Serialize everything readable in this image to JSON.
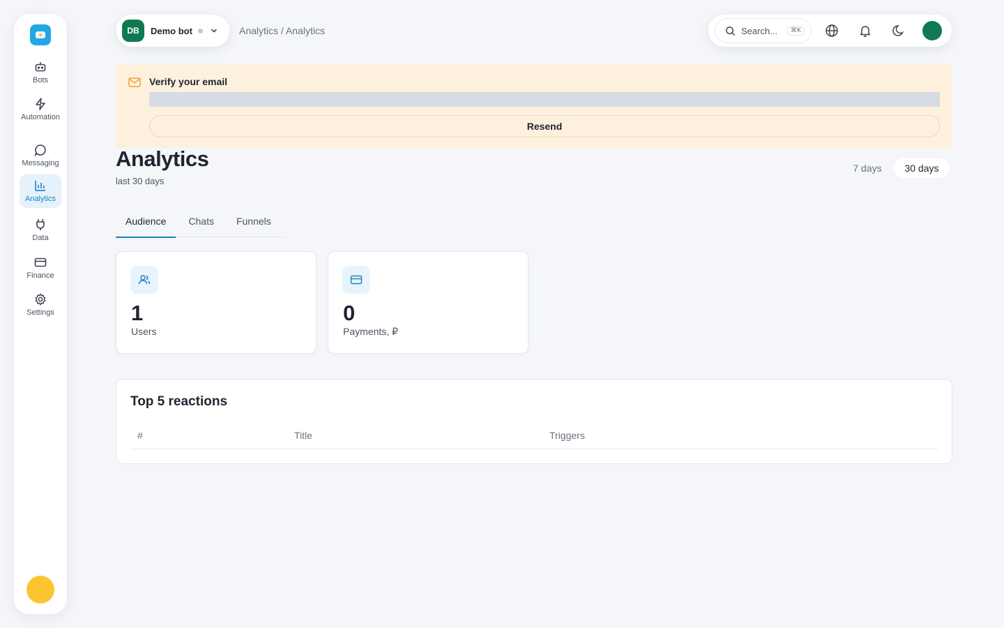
{
  "sidebar": {
    "logo_icon": "app-logo-icon",
    "items": [
      {
        "label": "Bots",
        "icon": "bot-icon",
        "active": false
      },
      {
        "label": "Automation",
        "icon": "lightning-icon",
        "active": false
      },
      {
        "label": "Messaging",
        "icon": "chat-bubble-icon",
        "active": false
      },
      {
        "label": "Analytics",
        "icon": "bar-chart-icon",
        "active": true
      },
      {
        "label": "Data",
        "icon": "plug-icon",
        "active": false
      },
      {
        "label": "Finance",
        "icon": "credit-card-icon",
        "active": false
      },
      {
        "label": "Settings",
        "icon": "gear-icon",
        "active": false
      }
    ]
  },
  "topbar": {
    "bot_initials": "DB",
    "bot_name": "Demo bot",
    "breadcrumb": "Analytics / Analytics",
    "search_placeholder": "Search...",
    "search_shortcut": "⌘K",
    "icons": [
      "globe-icon",
      "bell-icon",
      "moon-icon"
    ]
  },
  "banner": {
    "title": "Verify your email",
    "button_label": "Resend"
  },
  "header": {
    "title": "Analytics",
    "subtitle": "last 30 days",
    "ranges": [
      "7 days",
      "30 days"
    ],
    "selected_range": "30 days"
  },
  "tabs": [
    {
      "label": "Audience",
      "active": true
    },
    {
      "label": "Chats",
      "active": false
    },
    {
      "label": "Funnels",
      "active": false
    }
  ],
  "stats": [
    {
      "value": "1",
      "label": "Users",
      "icon": "users-icon"
    },
    {
      "value": "0",
      "label": "Payments, ₽",
      "icon": "card-icon"
    }
  ],
  "reactions": {
    "title": "Top 5 reactions",
    "columns": [
      "#",
      "Title",
      "Triggers"
    ],
    "rows": []
  },
  "colors": {
    "accent": "#1c82c4",
    "brand_green": "#0f7a52",
    "logo_blue": "#21a8e4",
    "banner_bg": "#fdf1de",
    "avatar_yellow": "#fbc531"
  }
}
